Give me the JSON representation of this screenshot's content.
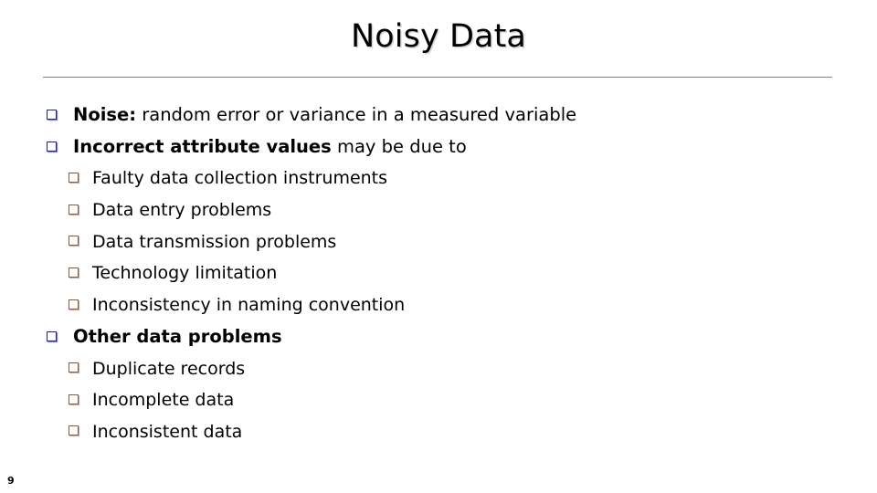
{
  "slide": {
    "title": "Noisy Data",
    "page_number": "9",
    "colors": {
      "background": "#ffffff",
      "text": "#000000",
      "rule": "#808080",
      "bullet_level1": "#1F1F8F",
      "bullet_level2": "#8B5A3C",
      "title_shadow": "#969696"
    },
    "bullet_glyph": "hollow-square-icon"
  },
  "bullets": [
    {
      "level": 1,
      "bold_text": "Noise:",
      "regular_text": " random error or variance in a measured variable",
      "full_text": "Noise: random error or variance in a measured variable"
    },
    {
      "level": 1,
      "bold_text": "Incorrect attribute values",
      "regular_text": " may be due to",
      "full_text": "Incorrect attribute values may be due to"
    },
    {
      "level": 2,
      "bold_text": "",
      "regular_text": "Faulty data collection instruments",
      "full_text": "Faulty data collection instruments"
    },
    {
      "level": 2,
      "bold_text": "",
      "regular_text": "Data entry problems",
      "full_text": "Data entry problems"
    },
    {
      "level": 2,
      "bold_text": "",
      "regular_text": "Data transmission problems",
      "full_text": "Data transmission problems"
    },
    {
      "level": 2,
      "bold_text": "",
      "regular_text": "Technology limitation",
      "full_text": "Technology limitation"
    },
    {
      "level": 2,
      "bold_text": "",
      "regular_text": "Inconsistency in naming convention",
      "full_text": "Inconsistency in naming convention"
    },
    {
      "level": 1,
      "bold_text": "Other data problems",
      "regular_text": "",
      "full_text": "Other data problems"
    },
    {
      "level": 2,
      "bold_text": "",
      "regular_text": "Duplicate records",
      "full_text": "Duplicate records"
    },
    {
      "level": 2,
      "bold_text": "",
      "regular_text": "Incomplete data",
      "full_text": "Incomplete data"
    },
    {
      "level": 2,
      "bold_text": "",
      "regular_text": "Inconsistent data",
      "full_text": "Inconsistent data"
    }
  ]
}
